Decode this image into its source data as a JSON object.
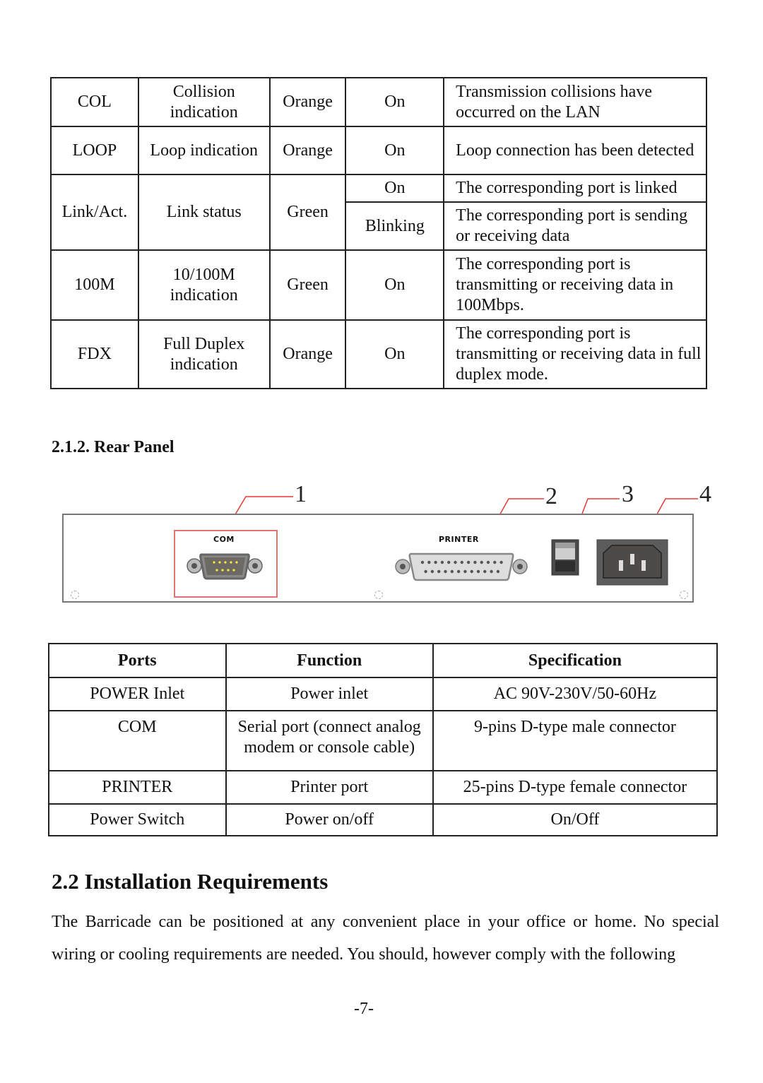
{
  "led_table": {
    "rows": [
      {
        "led": "COL",
        "function": "Collision indication",
        "color": "Orange",
        "status": "On",
        "description": "Transmission collisions have occurred on the LAN"
      },
      {
        "led": "LOOP",
        "function": "Loop indication",
        "color": "Orange",
        "status": "On",
        "description": "Loop connection has been detected"
      },
      {
        "led": "Link/Act.",
        "function": "Link status",
        "color": "Green",
        "states": [
          {
            "status": "On",
            "description": "The corresponding port is linked"
          },
          {
            "status": "Blinking",
            "description": "The corresponding port is sending or receiving data"
          }
        ]
      },
      {
        "led": "100M",
        "function": "10/100M indication",
        "color": "Green",
        "status": "On",
        "description": "The corresponding port is transmitting or receiving data in 100Mbps."
      },
      {
        "led": "FDX",
        "function": "Full Duplex indication",
        "color": "Orange",
        "status": "On",
        "description": "The corresponding port is transmitting or receiving data in full duplex mode."
      }
    ]
  },
  "rear_panel": {
    "heading": "2.1.2. Rear Panel",
    "diagram": {
      "port_labels": {
        "com": "COM",
        "printer": "PRINTER"
      },
      "callouts": [
        "1",
        "2",
        "3",
        "4"
      ],
      "callout_color": "#e53935"
    }
  },
  "ports_table": {
    "headers": [
      "Ports",
      "Function",
      "Specification"
    ],
    "rows": [
      {
        "port": "POWER Inlet",
        "function": "Power inlet",
        "specification": "AC 90V-230V/50-60Hz"
      },
      {
        "port": "COM",
        "function": "Serial port (connect analog modem or console cable)",
        "specification": "9-pins D-type male connector"
      },
      {
        "port": "PRINTER",
        "function": "Printer port",
        "specification": "25-pins D-type female connector"
      },
      {
        "port": "Power Switch",
        "function": "Power on/off",
        "specification": "On/Off"
      }
    ]
  },
  "installation": {
    "heading": "2.2 Installation Requirements",
    "body": "The Barricade can be positioned at any convenient place in your office or home. No special wiring or cooling requirements are needed. You should, however comply with the following"
  },
  "page_number": "-7-"
}
